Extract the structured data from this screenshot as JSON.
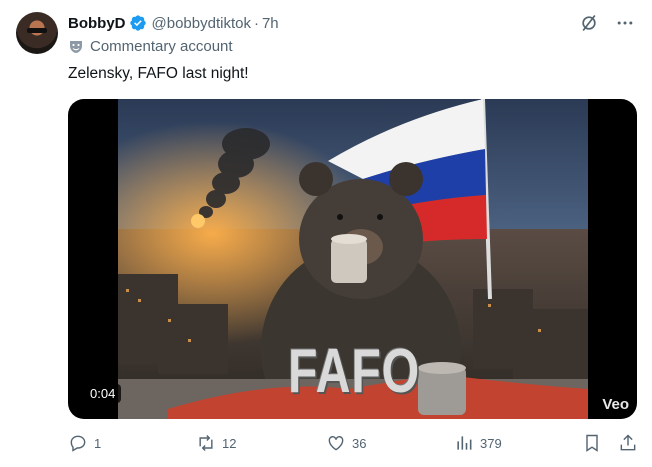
{
  "author": {
    "display_name": "BobbyD",
    "handle": "@bobbydtiktok",
    "separator": "·",
    "time": "7h",
    "label": "Commentary account"
  },
  "tweet": {
    "text": "Zelensky, FAFO last night!"
  },
  "media": {
    "overlay_text": "FAFO",
    "duration": "0:04",
    "watermark": "Veo"
  },
  "actions": {
    "replies": "1",
    "reposts": "12",
    "likes": "36",
    "views": "379"
  },
  "colors": {
    "verified": "#1d9bf0",
    "muted_text": "#536471",
    "text": "#0f1419"
  },
  "icons": [
    "grok-icon",
    "more-icon",
    "verified-badge-icon",
    "mask-icon",
    "reply-icon",
    "repost-icon",
    "like-icon",
    "views-icon",
    "bookmark-icon",
    "share-icon"
  ]
}
